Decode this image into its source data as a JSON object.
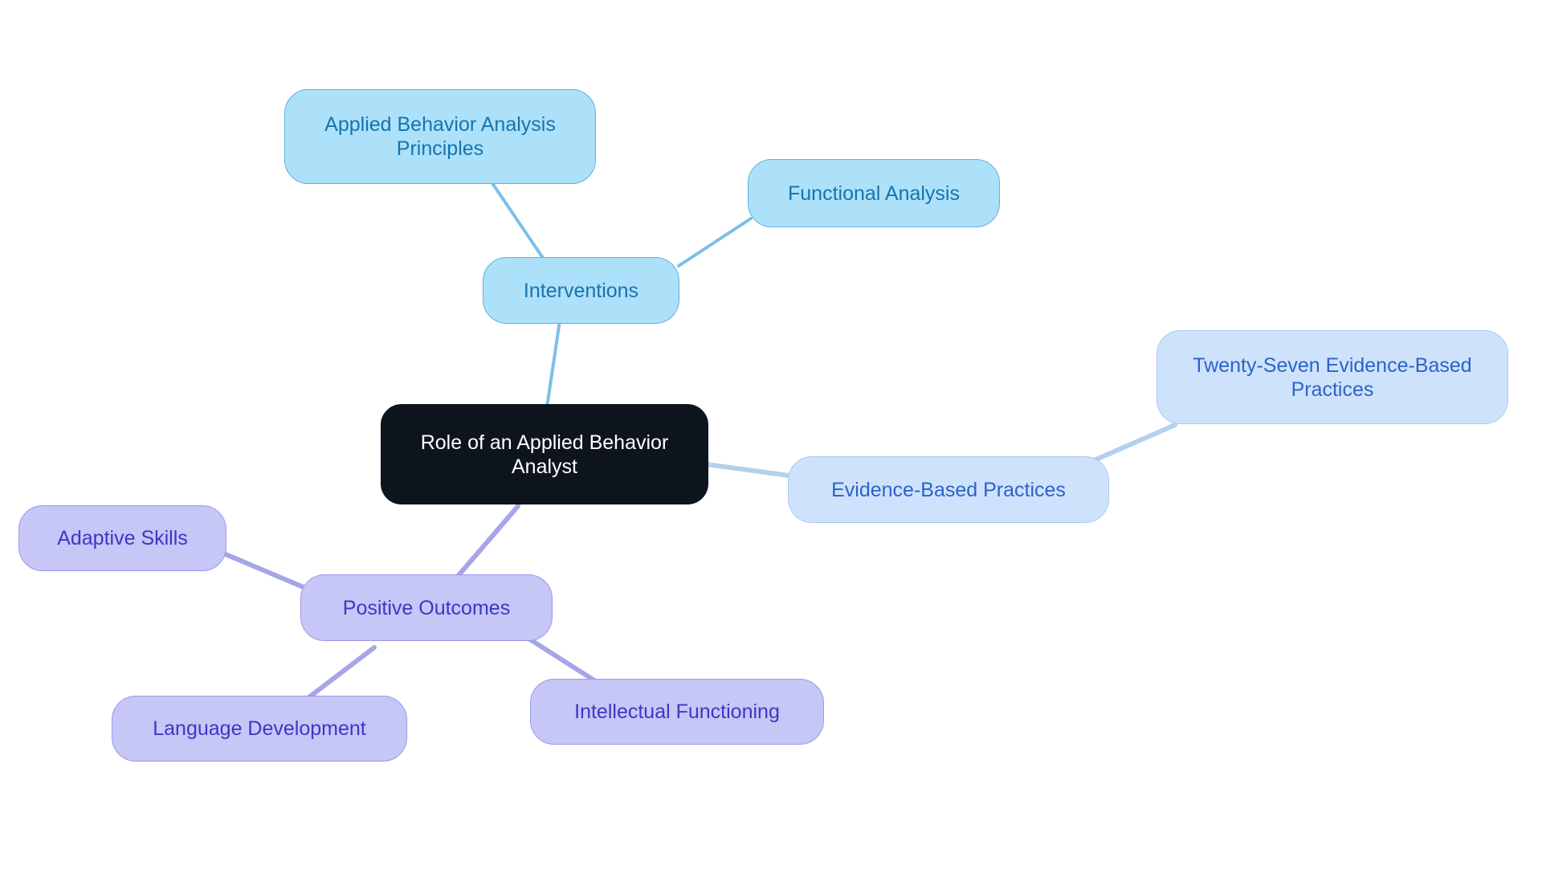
{
  "diagram": {
    "type": "mindmap",
    "title": "Role of an Applied Behavior Analyst",
    "background_color": "#ffffff",
    "palette": {
      "root_fill": "#0d141d",
      "root_text": "#ffffff",
      "blue_fill": "#ade1fa",
      "blue_border": "#63aedd",
      "blue_text": "#1574ad",
      "blue_edge": "#7cc0e8",
      "periwinkle_fill": "#cfe2fc",
      "periwinkle_border": "#a9c9ef",
      "periwinkle_text": "#2b63c8",
      "periwinkle_edge": "#b5d0ee",
      "lavender_fill": "#c6c6f7",
      "lavender_border": "#9a9aea",
      "lavender_text": "#3a38c6",
      "lavender_edge": "#a5a5e8"
    },
    "nodes": [
      {
        "id": "root",
        "label": "Role of an Applied Behavior\nAnalyst",
        "level": 0,
        "branch": "root"
      },
      {
        "id": "interventions",
        "label": "Interventions",
        "level": 1,
        "branch": "blue"
      },
      {
        "id": "aba-principles",
        "label": "Applied Behavior Analysis\nPrinciples",
        "level": 2,
        "branch": "blue"
      },
      {
        "id": "functional-analysis",
        "label": "Functional Analysis",
        "level": 2,
        "branch": "blue"
      },
      {
        "id": "evidence-based-practices",
        "label": "Evidence-Based Practices",
        "level": 1,
        "branch": "periwinkle"
      },
      {
        "id": "twenty-seven-ebp",
        "label": "Twenty-Seven Evidence-Based\nPractices",
        "level": 2,
        "branch": "periwinkle"
      },
      {
        "id": "positive-outcomes",
        "label": "Positive Outcomes",
        "level": 1,
        "branch": "lavender"
      },
      {
        "id": "adaptive-skills",
        "label": "Adaptive Skills",
        "level": 2,
        "branch": "lavender"
      },
      {
        "id": "language-development",
        "label": "Language Development",
        "level": 2,
        "branch": "lavender"
      },
      {
        "id": "intellectual-functioning",
        "label": "Intellectual Functioning",
        "level": 2,
        "branch": "lavender"
      }
    ],
    "edges": [
      {
        "from": "root",
        "to": "interventions",
        "color": "#7cc0e8"
      },
      {
        "from": "interventions",
        "to": "aba-principles",
        "color": "#7cc0e8"
      },
      {
        "from": "interventions",
        "to": "functional-analysis",
        "color": "#7cc0e8"
      },
      {
        "from": "root",
        "to": "evidence-based-practices",
        "color": "#b5d0ee"
      },
      {
        "from": "evidence-based-practices",
        "to": "twenty-seven-ebp",
        "color": "#b5d0ee"
      },
      {
        "from": "root",
        "to": "positive-outcomes",
        "color": "#a5a5e8"
      },
      {
        "from": "positive-outcomes",
        "to": "adaptive-skills",
        "color": "#a5a5e8"
      },
      {
        "from": "positive-outcomes",
        "to": "language-development",
        "color": "#a5a5e8"
      },
      {
        "from": "positive-outcomes",
        "to": "intellectual-functioning",
        "color": "#a5a5e8"
      }
    ]
  }
}
